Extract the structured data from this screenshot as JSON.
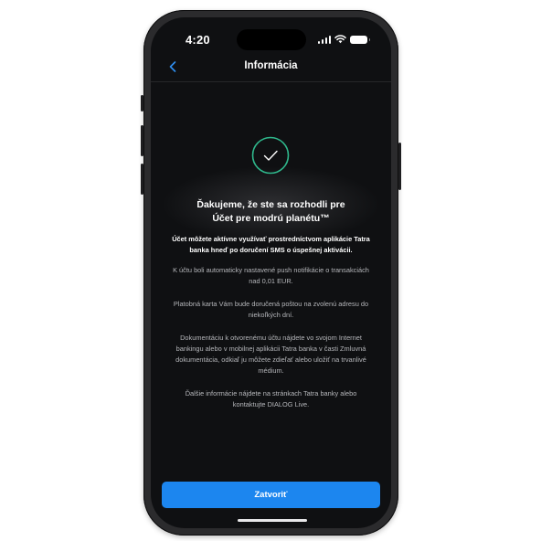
{
  "status_bar": {
    "time": "4:20"
  },
  "nav": {
    "title": "Informácia"
  },
  "content": {
    "heading_line1": "Ďakujeme, že ste sa rozhodli pre",
    "heading_line2": "Účet pre modrú planétu™",
    "intro_line1": "Účet môžete aktívne využívať prostredníctvom aplikácie Tatra",
    "intro_line2": "banka hneď po doručení SMS o úspešnej aktivácii.",
    "p1_line1": "K účtu boli automaticky nastavené push notifikácie o transakciách",
    "p1_line2": "nad 0,01 EUR.",
    "p2_line1": "Platobná karta Vám bude doručená poštou na zvolenú adresu do",
    "p2_line2": "niekoľkých dní.",
    "p3_line1": "Dokumentáciu k otvorenému účtu nájdete vo svojom Internet",
    "p3_line2": "bankingu alebo v mobilnej aplikácii Tatra banka v časti Zmluvná",
    "p3_line3": "dokumentácia, odkiaľ ju môžete zdieľať alebo uložiť na trvanlivé",
    "p3_line4": "médium.",
    "p4_line1": "Ďalšie informácie nájdete na stránkach Tatra banky alebo",
    "p4_line2": "kontaktujte DIALOG Live."
  },
  "button": {
    "label": "Zatvoriť"
  },
  "colors": {
    "accent": "#1c86ef",
    "success_ring": "#2fb88c",
    "background": "#0f1012"
  },
  "icons": {
    "back": "chevron-left-icon",
    "success": "checkmark-circle-icon"
  }
}
